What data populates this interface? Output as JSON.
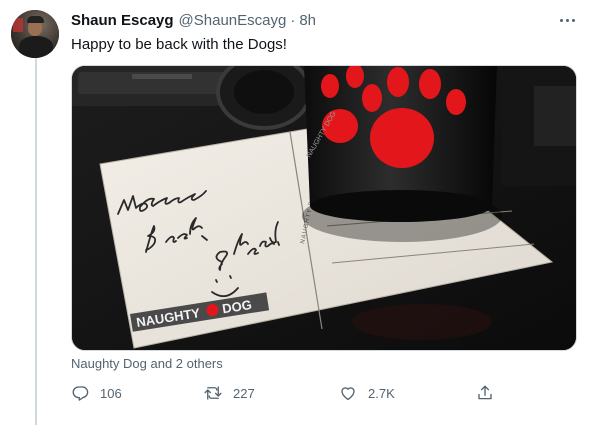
{
  "tweet": {
    "author_name": "Shaun Escayg",
    "author_handle": "@ShaunEscayg",
    "separator": "·",
    "time": "8h",
    "text": "Happy to be back with the Dogs!",
    "liked_by": "Naughty Dog and 2 others",
    "reply_count": "106",
    "retweet_count": "227",
    "like_count": "2.7K"
  },
  "media": {
    "handwritten_note": "Welcome Back, Shaun! :)",
    "postcard_logo": "NAUGHTY DOG",
    "postcard_vertical_text": "NAUGHTY DOG POSTCARD",
    "mug_text": "NAUGHTY DOG"
  },
  "icons": {
    "more": "more-dots-icon",
    "reply": "reply-icon",
    "retweet": "retweet-icon",
    "like": "heart-icon",
    "share": "share-icon"
  },
  "colors": {
    "text_primary": "#0f1419",
    "text_secondary": "#536471",
    "divider": "#cfd9de",
    "paw_red": "#e3171b"
  }
}
